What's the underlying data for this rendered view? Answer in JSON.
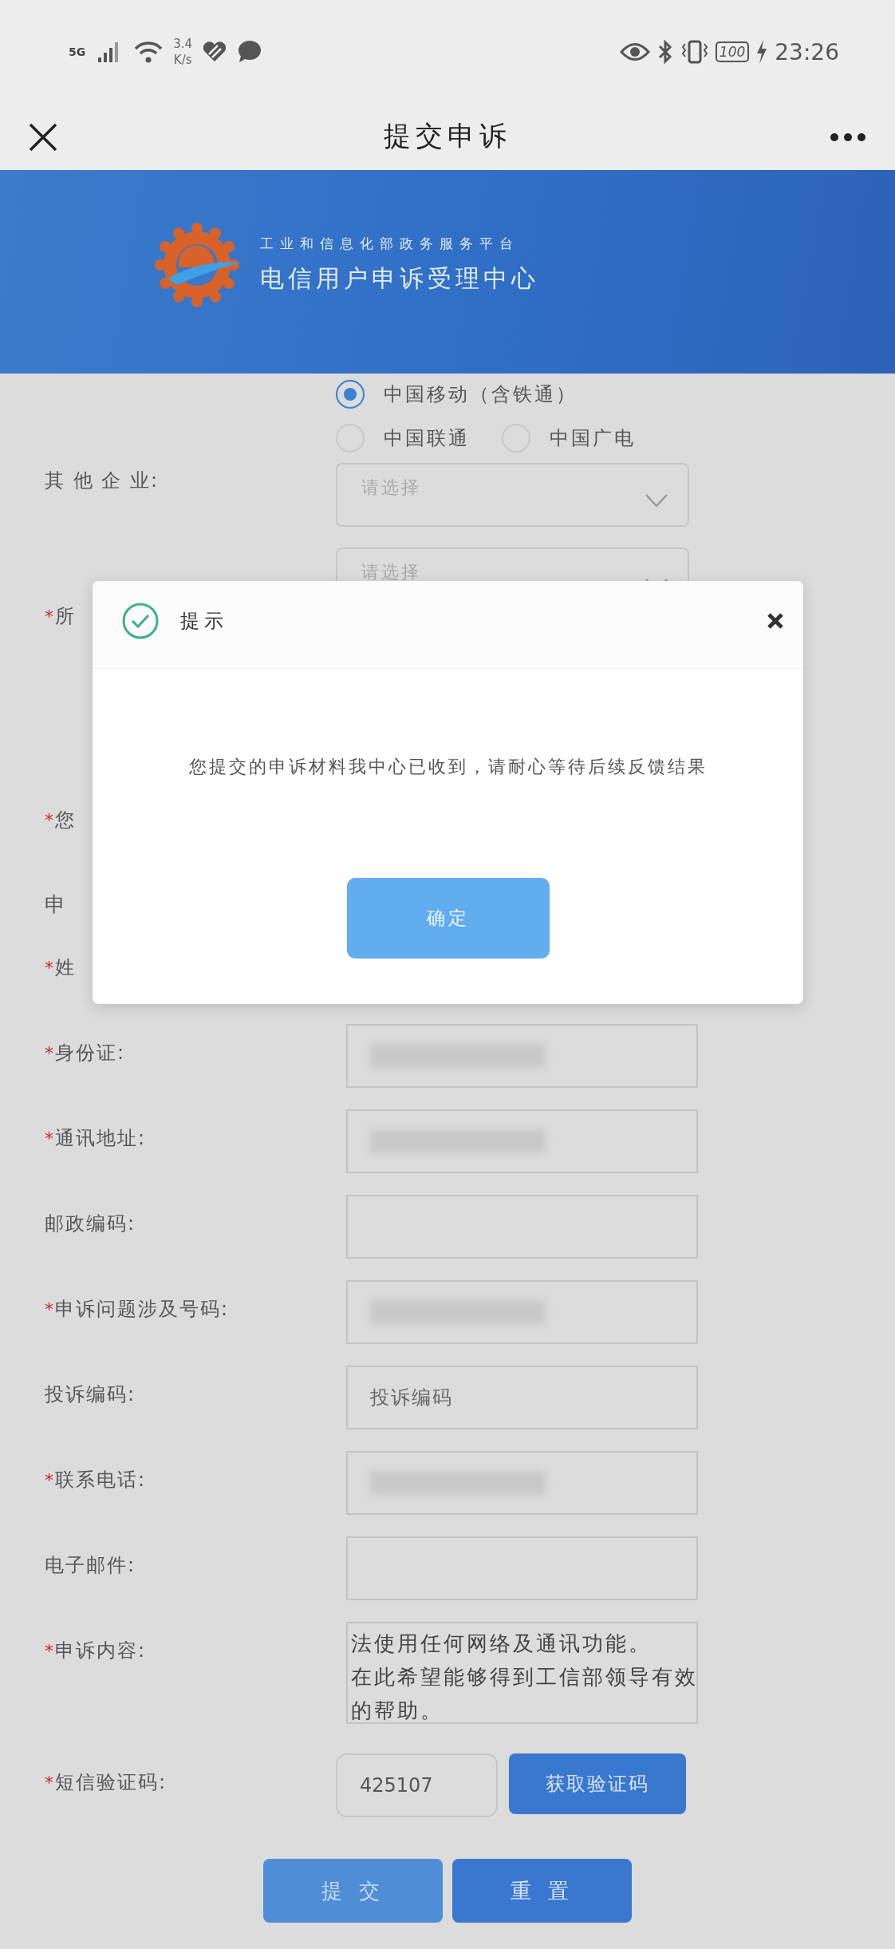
{
  "status_bar": {
    "network": "5G",
    "speed": "3.4",
    "speed_unit": "K/s",
    "battery": "100",
    "time": "23:26"
  },
  "nav": {
    "title": "提交申诉"
  },
  "banner": {
    "subtitle": "工业和信息化部政务服务平台",
    "title": "电信用户申诉受理中心"
  },
  "form": {
    "operators": [
      {
        "label": "中国移动（含铁通）",
        "selected": true
      },
      {
        "label": "中国联通",
        "selected": false
      },
      {
        "label": "中国广电",
        "selected": false
      }
    ],
    "rows": [
      {
        "kind": "select",
        "label": "其 他 企 业:",
        "placeholder": "请选择"
      },
      {
        "kind": "select",
        "placeholder": "请选择"
      },
      {
        "kind": "covered",
        "mark": "*",
        "label": "所"
      },
      {
        "kind": "covered",
        "mark": "*",
        "label": "您"
      },
      {
        "kind": "heading",
        "label": "申"
      },
      {
        "kind": "covered",
        "mark": "*",
        "label": "姓"
      },
      {
        "kind": "text",
        "mark": "*",
        "label": "身份证:",
        "redacted": true
      },
      {
        "kind": "text",
        "mark": "*",
        "label": "通讯地址:",
        "redacted": true
      },
      {
        "kind": "text",
        "label": "邮政编码:"
      },
      {
        "kind": "text",
        "mark": "*",
        "label": "申诉问题涉及号码:",
        "redacted": true
      },
      {
        "kind": "text",
        "label": "投诉编码:",
        "placeholder": "投诉编码"
      },
      {
        "kind": "text",
        "mark": "*",
        "label": "联系电话:",
        "redacted": true
      },
      {
        "kind": "text",
        "label": "电子邮件:"
      },
      {
        "kind": "textarea",
        "mark": "*",
        "label": "申诉内容:",
        "lines": [
          "法使用任何网络及通讯功能。",
          "在此希望能够得到工信部领导有效",
          "的帮助。"
        ]
      },
      {
        "kind": "sms",
        "mark": "*",
        "label": "短信验证码:",
        "value": "425107",
        "button": "获取验证码"
      }
    ],
    "actions": [
      {
        "label": "提 交",
        "disabled": true
      },
      {
        "label": "重 置",
        "disabled": false
      }
    ]
  },
  "dialog": {
    "title": "提示",
    "message": "您提交的申诉材料我中心已收到，请耐心等待后续反馈结果",
    "button": "确定"
  }
}
